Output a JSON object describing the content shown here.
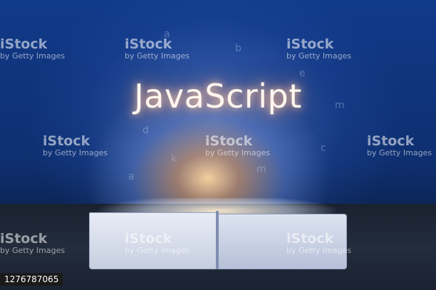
{
  "image": {
    "headline": "JavaScript",
    "stock_id": "1276787065"
  },
  "watermarks": [
    {
      "brand": "iStock",
      "sub": "by Getty Images"
    },
    {
      "brand": "iStock",
      "sub": "by Getty Images"
    },
    {
      "brand": "iStock",
      "sub": "by Getty Images"
    },
    {
      "brand": "iStock",
      "sub": "by Getty Images"
    },
    {
      "brand": "iStock",
      "sub": "by Getty Images"
    },
    {
      "brand": "iStock",
      "sub": "by Getty Images"
    },
    {
      "brand": "iStock",
      "sub": "by Getty Images"
    },
    {
      "brand": "iStock",
      "sub": "by Getty Images"
    }
  ],
  "colors": {
    "background": "#113a8a",
    "glow": "#ffd6a0",
    "title_text": "#fff6ef"
  }
}
